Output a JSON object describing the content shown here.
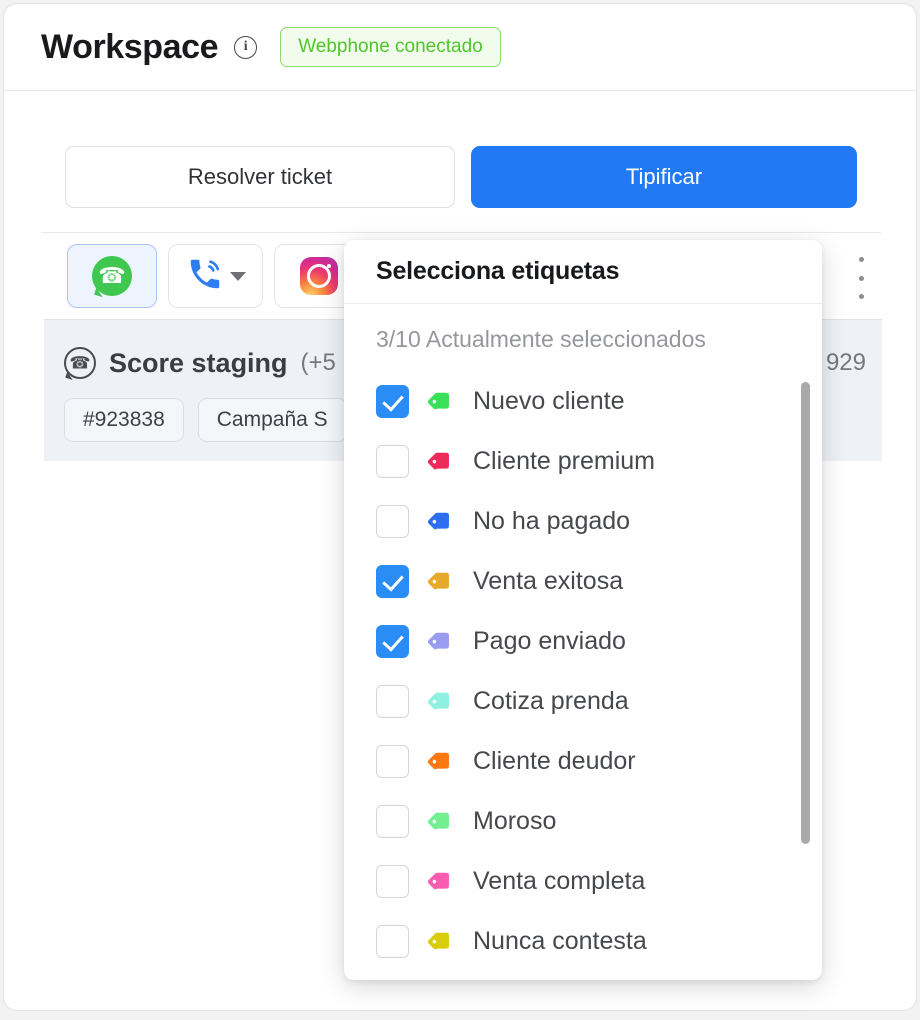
{
  "header": {
    "title": "Workspace",
    "info_icon": "info-icon",
    "badge": "Webphone conectado",
    "badge_text_color": "#4fc72b",
    "badge_bg_color": "#f2fcec",
    "badge_border_color": "#8fdc6d"
  },
  "actions": {
    "resolve_label": "Resolver ticket",
    "classify_label": "Tipificar",
    "primary_color": "#2279f5"
  },
  "channels": [
    {
      "name": "whatsapp",
      "icon": "whatsapp-icon",
      "active": true,
      "has_caret": false
    },
    {
      "name": "phone",
      "icon": "phone-call-icon",
      "active": false,
      "has_caret": true
    },
    {
      "name": "instagram",
      "icon": "instagram-icon",
      "active": false,
      "has_caret": false
    }
  ],
  "overflow_menu_icon": "kebab-menu-icon",
  "contact": {
    "channel_icon": "whatsapp-outline-icon",
    "name": "Score staging",
    "phone": "(+5",
    "phone_tail": "929",
    "chips": [
      "#923838",
      "Campaña S"
    ]
  },
  "dropdown": {
    "title": "Selecciona etiquetas",
    "count_text": "3/10 Actualmente seleccionados",
    "items": [
      {
        "label": "Nuevo cliente",
        "checked": true,
        "color": "#3ae05a"
      },
      {
        "label": "Cliente premium",
        "checked": false,
        "color": "#ec2b5b"
      },
      {
        "label": "No ha pagado",
        "checked": false,
        "color": "#2d6ef0"
      },
      {
        "label": "Venta exitosa",
        "checked": true,
        "color": "#e7a92c"
      },
      {
        "label": "Pago enviado",
        "checked": false,
        "color": "#9a9cf0"
      },
      {
        "label": "Cotiza prenda",
        "checked": false,
        "color": "#8df0e0"
      },
      {
        "label": "Cliente deudor",
        "checked": false,
        "color": "#fb7712"
      },
      {
        "label": "Moroso",
        "checked": false,
        "color": "#73ef92"
      },
      {
        "label": "Venta completa",
        "checked": false,
        "color": "#fa5cb0"
      },
      {
        "label": "Nunca contesta",
        "checked": false,
        "color": "#d9cc0b"
      }
    ],
    "checked_override": {
      "4": true,
      "5": false
    },
    "checkbox_color": "#2a8cf5"
  }
}
